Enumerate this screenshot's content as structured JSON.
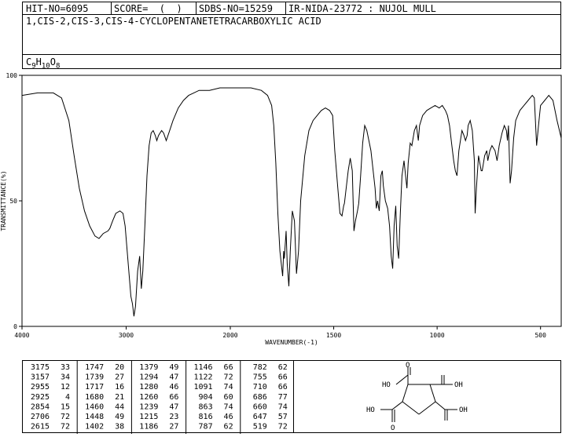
{
  "header": {
    "hit_no": "HIT-NO=6095",
    "score": "SCORE=  (  )",
    "sdbs_no": "SDBS-NO=15259",
    "ir_code": "IR-NIDA-23772 : NUJOL MULL",
    "compound_name": "1,CIS-2,CIS-3,CIS-4-CYCLOPENTANETETRACARBOXYLIC ACID",
    "formula_main": "C",
    "formula_parts": [
      {
        "t": "C",
        "sub": false
      },
      {
        "t": "9",
        "sub": true
      },
      {
        "t": "H",
        "sub": false
      },
      {
        "t": "10",
        "sub": true
      },
      {
        "t": "O",
        "sub": false
      },
      {
        "t": "8",
        "sub": true
      }
    ]
  },
  "chart_data": {
    "type": "line",
    "xlabel": "WAVENUMBER(-1)",
    "ylabel": "TRANSMITTANCE(%)",
    "xlim": [
      4000,
      400
    ],
    "ylim": [
      0,
      100
    ],
    "x_ticks": [
      4000,
      3000,
      2000,
      1500,
      1000,
      500
    ],
    "y_ticks": [
      0,
      50,
      100
    ],
    "series": [
      {
        "points": [
          [
            4000,
            92
          ],
          [
            3850,
            93
          ],
          [
            3700,
            93
          ],
          [
            3620,
            91
          ],
          [
            3550,
            82
          ],
          [
            3500,
            68
          ],
          [
            3450,
            55
          ],
          [
            3400,
            46
          ],
          [
            3350,
            40
          ],
          [
            3300,
            36
          ],
          [
            3260,
            35
          ],
          [
            3220,
            37
          ],
          [
            3175,
            38
          ],
          [
            3157,
            39
          ],
          [
            3130,
            42
          ],
          [
            3100,
            45
          ],
          [
            3060,
            46
          ],
          [
            3030,
            45
          ],
          [
            3010,
            40
          ],
          [
            2990,
            30
          ],
          [
            2955,
            12
          ],
          [
            2940,
            9
          ],
          [
            2925,
            4
          ],
          [
            2910,
            8
          ],
          [
            2890,
            22
          ],
          [
            2870,
            28
          ],
          [
            2854,
            15
          ],
          [
            2840,
            22
          ],
          [
            2820,
            40
          ],
          [
            2800,
            60
          ],
          [
            2780,
            72
          ],
          [
            2760,
            77
          ],
          [
            2740,
            78
          ],
          [
            2720,
            76
          ],
          [
            2706,
            74
          ],
          [
            2690,
            76
          ],
          [
            2660,
            78
          ],
          [
            2640,
            77
          ],
          [
            2615,
            74
          ],
          [
            2590,
            77
          ],
          [
            2550,
            82
          ],
          [
            2500,
            87
          ],
          [
            2450,
            90
          ],
          [
            2400,
            92
          ],
          [
            2350,
            93
          ],
          [
            2300,
            94
          ],
          [
            2200,
            94
          ],
          [
            2100,
            95
          ],
          [
            2000,
            95
          ],
          [
            1900,
            95
          ],
          [
            1850,
            94
          ],
          [
            1820,
            92
          ],
          [
            1800,
            88
          ],
          [
            1790,
            80
          ],
          [
            1780,
            65
          ],
          [
            1770,
            45
          ],
          [
            1760,
            30
          ],
          [
            1747,
            20
          ],
          [
            1742,
            30
          ],
          [
            1739,
            27
          ],
          [
            1730,
            38
          ],
          [
            1725,
            25
          ],
          [
            1717,
            16
          ],
          [
            1710,
            30
          ],
          [
            1700,
            46
          ],
          [
            1690,
            42
          ],
          [
            1680,
            21
          ],
          [
            1670,
            30
          ],
          [
            1660,
            50
          ],
          [
            1640,
            68
          ],
          [
            1620,
            78
          ],
          [
            1600,
            82
          ],
          [
            1580,
            84
          ],
          [
            1560,
            86
          ],
          [
            1540,
            87
          ],
          [
            1520,
            86
          ],
          [
            1505,
            84
          ],
          [
            1495,
            70
          ],
          [
            1480,
            55
          ],
          [
            1470,
            45
          ],
          [
            1460,
            44
          ],
          [
            1452,
            48
          ],
          [
            1448,
            49
          ],
          [
            1440,
            55
          ],
          [
            1430,
            62
          ],
          [
            1420,
            67
          ],
          [
            1410,
            62
          ],
          [
            1402,
            38
          ],
          [
            1395,
            42
          ],
          [
            1385,
            46
          ],
          [
            1379,
            49
          ],
          [
            1370,
            60
          ],
          [
            1360,
            73
          ],
          [
            1350,
            80
          ],
          [
            1340,
            78
          ],
          [
            1320,
            70
          ],
          [
            1300,
            55
          ],
          [
            1294,
            47
          ],
          [
            1288,
            50
          ],
          [
            1280,
            46
          ],
          [
            1272,
            60
          ],
          [
            1265,
            62
          ],
          [
            1260,
            56
          ],
          [
            1250,
            50
          ],
          [
            1239,
            47
          ],
          [
            1230,
            40
          ],
          [
            1222,
            28
          ],
          [
            1215,
            23
          ],
          [
            1208,
            40
          ],
          [
            1200,
            48
          ],
          [
            1193,
            32
          ],
          [
            1186,
            27
          ],
          [
            1178,
            45
          ],
          [
            1170,
            60
          ],
          [
            1160,
            66
          ],
          [
            1146,
            55
          ],
          [
            1140,
            65
          ],
          [
            1130,
            73
          ],
          [
            1122,
            72
          ],
          [
            1110,
            78
          ],
          [
            1100,
            80
          ],
          [
            1091,
            74
          ],
          [
            1085,
            80
          ],
          [
            1070,
            84
          ],
          [
            1050,
            86
          ],
          [
            1030,
            87
          ],
          [
            1010,
            88
          ],
          [
            990,
            87
          ],
          [
            975,
            88
          ],
          [
            960,
            86
          ],
          [
            950,
            84
          ],
          [
            940,
            80
          ],
          [
            930,
            73
          ],
          [
            920,
            66
          ],
          [
            912,
            62
          ],
          [
            904,
            60
          ],
          [
            895,
            70
          ],
          [
            880,
            78
          ],
          [
            870,
            76
          ],
          [
            863,
            74
          ],
          [
            855,
            76
          ],
          [
            850,
            80
          ],
          [
            840,
            82
          ],
          [
            830,
            78
          ],
          [
            820,
            66
          ],
          [
            816,
            45
          ],
          [
            810,
            55
          ],
          [
            800,
            68
          ],
          [
            787,
            62
          ],
          [
            782,
            62
          ],
          [
            770,
            68
          ],
          [
            760,
            70
          ],
          [
            755,
            66
          ],
          [
            745,
            70
          ],
          [
            735,
            72
          ],
          [
            720,
            70
          ],
          [
            710,
            66
          ],
          [
            700,
            72
          ],
          [
            686,
            77
          ],
          [
            675,
            80
          ],
          [
            665,
            78
          ],
          [
            660,
            74
          ],
          [
            655,
            80
          ],
          [
            647,
            57
          ],
          [
            640,
            62
          ],
          [
            630,
            75
          ],
          [
            620,
            82
          ],
          [
            600,
            86
          ],
          [
            580,
            88
          ],
          [
            560,
            90
          ],
          [
            540,
            92
          ],
          [
            530,
            91
          ],
          [
            519,
            72
          ],
          [
            510,
            80
          ],
          [
            500,
            88
          ],
          [
            480,
            90
          ],
          [
            460,
            92
          ],
          [
            440,
            90
          ],
          [
            420,
            82
          ],
          [
            400,
            75
          ]
        ]
      }
    ]
  },
  "peak_table": {
    "columns": [
      [
        [
          "3175",
          "33"
        ],
        [
          "3157",
          "34"
        ],
        [
          "2955",
          "12"
        ],
        [
          "2925",
          "4"
        ],
        [
          "2854",
          "15"
        ],
        [
          "2706",
          "72"
        ],
        [
          "2615",
          "72"
        ]
      ],
      [
        [
          "1747",
          "20"
        ],
        [
          "1739",
          "27"
        ],
        [
          "1717",
          "16"
        ],
        [
          "1680",
          "21"
        ],
        [
          "1460",
          "44"
        ],
        [
          "1448",
          "49"
        ],
        [
          "1402",
          "38"
        ]
      ],
      [
        [
          "1379",
          "49"
        ],
        [
          "1294",
          "47"
        ],
        [
          "1280",
          "46"
        ],
        [
          "1260",
          "66"
        ],
        [
          "1239",
          "47"
        ],
        [
          "1215",
          "23"
        ],
        [
          "1186",
          "27"
        ]
      ],
      [
        [
          "1146",
          "66"
        ],
        [
          "1122",
          "72"
        ],
        [
          "1091",
          "74"
        ],
        [
          "904",
          "60"
        ],
        [
          "863",
          "74"
        ],
        [
          "816",
          "46"
        ],
        [
          "787",
          "62"
        ]
      ],
      [
        [
          "782",
          "62"
        ],
        [
          "755",
          "66"
        ],
        [
          "710",
          "66"
        ],
        [
          "686",
          "77"
        ],
        [
          "660",
          "74"
        ],
        [
          "647",
          "57"
        ],
        [
          "519",
          "72"
        ]
      ]
    ]
  },
  "structure": {
    "labels": {
      "o_top": "O",
      "ho_left": "HO",
      "oh_right_top": "OH",
      "ho_bottom": "HO",
      "oh_bottom_right": "OH",
      "o_bottom": "O"
    }
  }
}
